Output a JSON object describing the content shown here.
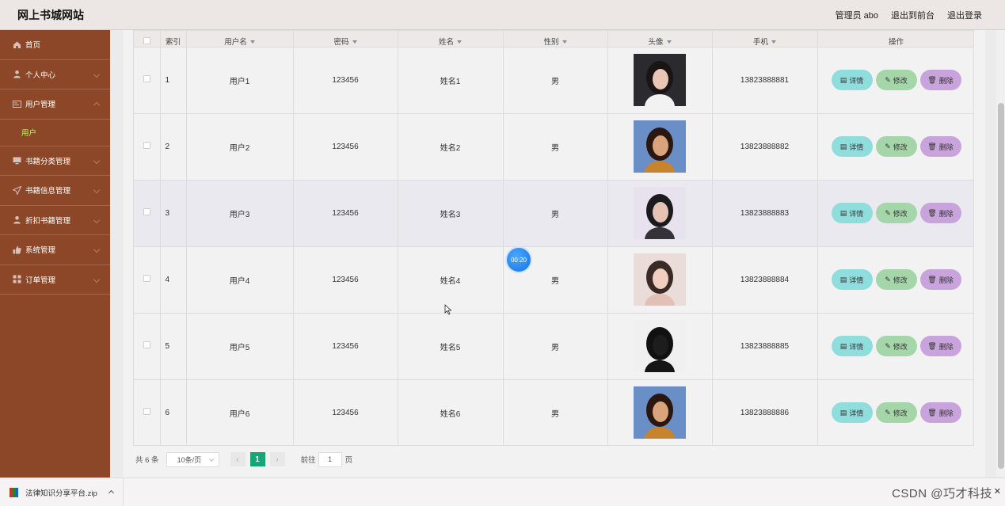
{
  "header": {
    "title": "网上书城网站",
    "user": "管理员 abo",
    "front_link": "退出到前台",
    "logout_link": "退出登录"
  },
  "sidebar": {
    "items": [
      {
        "label": "首页",
        "icon": "home-icon",
        "has_chevron": false
      },
      {
        "label": "个人中心",
        "icon": "person-icon",
        "has_chevron": true
      },
      {
        "label": "用户管理",
        "icon": "user-admin-icon",
        "has_chevron": true,
        "expanded": true
      },
      {
        "label": "书籍分类管理",
        "icon": "monitor-icon",
        "has_chevron": true
      },
      {
        "label": "书籍信息管理",
        "icon": "send-icon",
        "has_chevron": true
      },
      {
        "label": "折扣书籍管理",
        "icon": "person-icon",
        "has_chevron": true
      },
      {
        "label": "系统管理",
        "icon": "thumb-icon",
        "has_chevron": true
      },
      {
        "label": "订单管理",
        "icon": "grid-icon",
        "has_chevron": true
      }
    ],
    "subitem": "用户"
  },
  "table": {
    "columns": [
      "索引",
      "用户名",
      "密码",
      "姓名",
      "性别",
      "头像",
      "手机",
      "操作"
    ],
    "rows": [
      {
        "index": "1",
        "username": "用户1",
        "password": "123456",
        "name": "姓名1",
        "gender": "男",
        "phone": "13823888881"
      },
      {
        "index": "2",
        "username": "用户2",
        "password": "123456",
        "name": "姓名2",
        "gender": "男",
        "phone": "13823888882"
      },
      {
        "index": "3",
        "username": "用户3",
        "password": "123456",
        "name": "姓名3",
        "gender": "男",
        "phone": "13823888883"
      },
      {
        "index": "4",
        "username": "用户4",
        "password": "123456",
        "name": "姓名4",
        "gender": "男",
        "phone": "13823888884"
      },
      {
        "index": "5",
        "username": "用户5",
        "password": "123456",
        "name": "姓名5",
        "gender": "男",
        "phone": "13823888885"
      },
      {
        "index": "6",
        "username": "用户6",
        "password": "123456",
        "name": "姓名6",
        "gender": "男",
        "phone": "13823888886"
      }
    ],
    "actions": {
      "detail": "详情",
      "edit": "修改",
      "delete": "删除"
    }
  },
  "pagination": {
    "total": "共 6 条",
    "page_size": "10条/页",
    "current_page": "1",
    "goto_label": "前往",
    "goto_value": "1",
    "goto_suffix": "页"
  },
  "timer": "00:20",
  "download": {
    "filename": "法律知识分享平台.zip"
  },
  "watermark": "CSDN @巧才科技",
  "colors": {
    "sidebar": "#8b4728",
    "active_sub": "#b6ff5e",
    "detail_btn": "#8fdedd",
    "edit_btn": "#a5d6a9",
    "delete_btn": "#c9a4dc",
    "page_active": "#13a677"
  }
}
